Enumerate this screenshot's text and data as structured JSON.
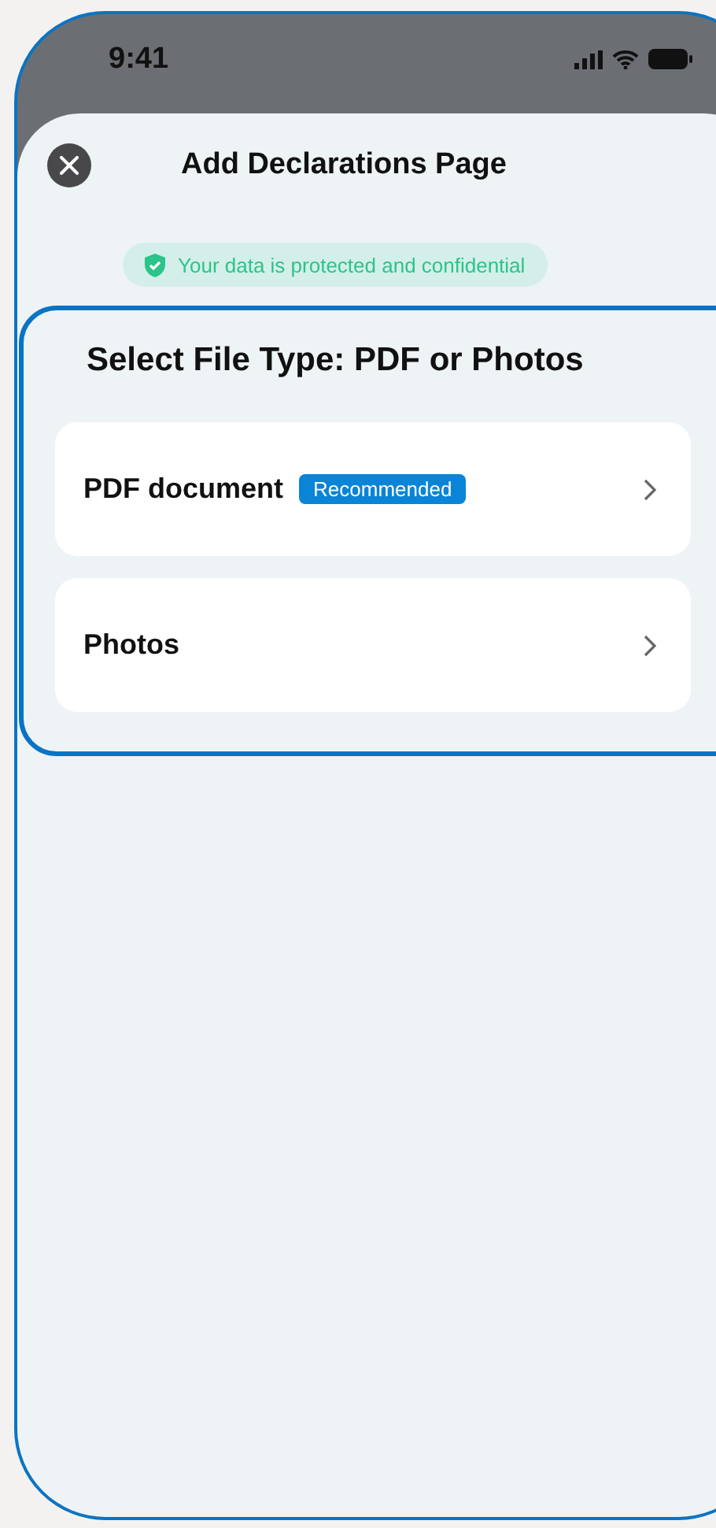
{
  "status_bar": {
    "time": "9:41"
  },
  "header": {
    "title": "Add Declarations Page"
  },
  "notice": {
    "text": "Your data is protected and confidential"
  },
  "file_type": {
    "title": "Select File Type: PDF or Photos",
    "options": [
      {
        "label": "PDF document",
        "badge": "Recommended"
      },
      {
        "label": "Photos"
      }
    ]
  }
}
